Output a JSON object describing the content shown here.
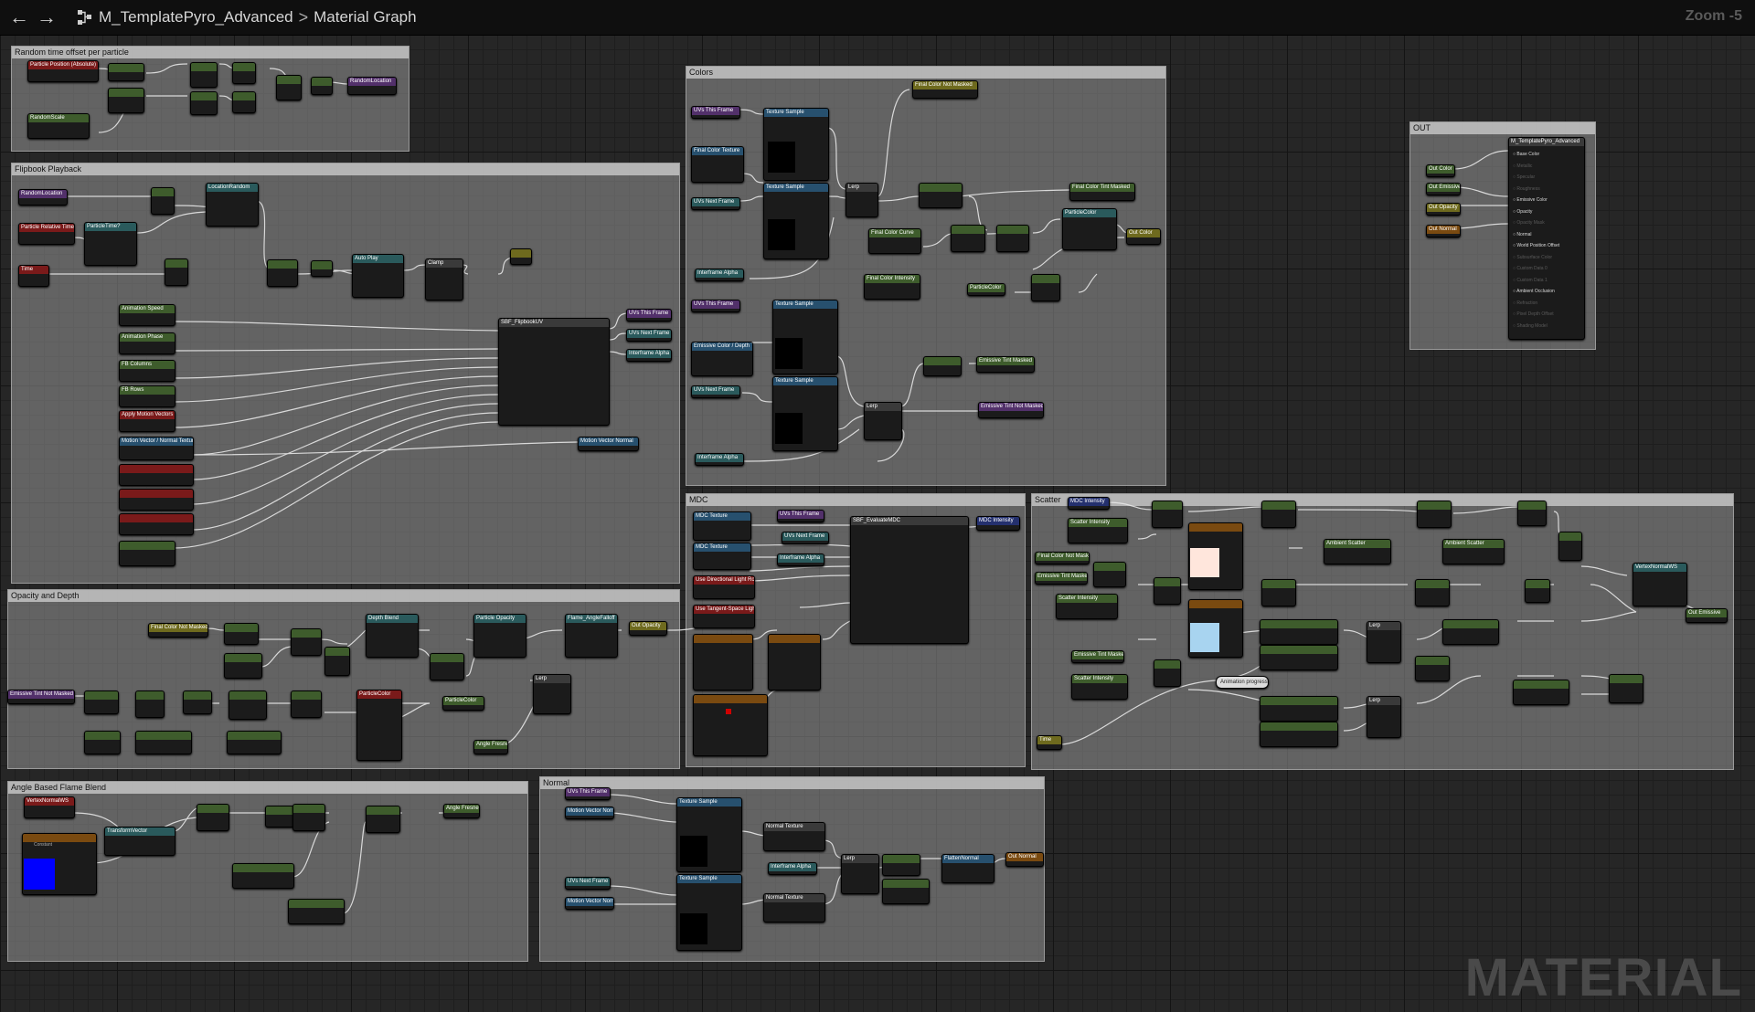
{
  "toolbar": {
    "back_icon": "arrow-left-icon",
    "forward_icon": "arrow-right-icon",
    "graph_icon": "material-graph-icon",
    "asset_name": "M_TemplatePyro_Advanced",
    "separator": ">",
    "graph_name": "Material Graph",
    "zoom": "Zoom -5"
  },
  "watermark": "MATERIAL",
  "comments": {
    "random_time": "Random time offset per particle",
    "flipbook": "Flipbook Playback",
    "colors": "Colors",
    "out": "OUT",
    "opacity_depth": "Opacity and Depth",
    "mdc": "MDC",
    "scatter": "Scatter",
    "angle_blend": "Angle Based Flame Blend",
    "normal": "Normal"
  },
  "nodes": {
    "particle_position": "Particle Position (Absolute)",
    "random_scale": "RandomScale",
    "random_location": "RandomLocation",
    "particle_relative_time": "Particle Relative Time",
    "particle_time": "ParticleTime?",
    "time": "Time",
    "location_random": "LocationRandom",
    "auto_play": "Auto Play",
    "clamp": "Clamp",
    "sf_flipbook": "SBF_FlipbookUV",
    "animation_speed": "Animation Speed",
    "animation_phase": "Animation Phase",
    "columns": "FB Columns",
    "rows": "FB Rows",
    "apply_motion_vectors": "Apply Motion Vectors",
    "motion_vector_texture": "Motion Vector / Normal Texture",
    "uv0_this_frame": "UVs This Frame",
    "uv_next_frame": "UVs Next Frame",
    "interframe_alpha": "Interframe Alpha",
    "motion_vector_normal": "Motion Vector Normal",
    "final_color_not_masked": "Final Color Not Masked",
    "texture_sample": "Texture Sample",
    "final_color_texture": "Final Color Texture",
    "final_color_tint": "Final Color Tint Masked",
    "final_color_curve": "Final Color Curve",
    "final_color_intensity": "Final Color Intensity",
    "particle_color": "ParticleColor",
    "emissive_color_depth": "Emissive Color / Depth Texture",
    "emissive_tint_masked": "Emissive Tint Masked",
    "emissive_tint_not_masked": "Emissive Tint Not Masked",
    "final_color_lerp": "Lerp",
    "out_node": "M_TemplatePyro_Advanced",
    "depth_blend": "Depth Blend",
    "particle_opacity": "Particle Opacity",
    "flame_angle_falloff": "Flame_AngleFalloff",
    "angle_fresnel": "Angle Fresnel",
    "mdc_texture": "MDC Texture",
    "mdc_intensity": "MDC Intensity",
    "sf_evaluate_mdc": "SBF_EvaluateMDC",
    "use_directional_light": "Use Directional Light Rotation",
    "use_tangent_space": "Use Tangent-Space Light Direction",
    "scatter_intensity": "Scatter Intensity",
    "ambient_scatter": "Ambient Scatter",
    "vertex_normal": "VertexNormalWS",
    "transform_vector": "TransformVector",
    "normal_texture": "Normal Texture",
    "flatten_normal": "FlattenNormal",
    "out_emissive": "Out Emissive",
    "out_opacity": "Out Opacity",
    "out_normal": "Out Normal",
    "out_color": "Out Color"
  },
  "out_pins": [
    "Base Color",
    "Metallic",
    "Specular",
    "Roughness",
    "Emissive Color",
    "Opacity",
    "Opacity Mask",
    "Normal",
    "World Position Offset",
    "Subsurface Color",
    "Custom Data 0",
    "Custom Data 1",
    "Ambient Occlusion",
    "Refraction",
    "Pixel Depth Offset",
    "Shading Model"
  ],
  "constant_blue_label": "Constant",
  "animation_progress": "Animation progress",
  "colors": {
    "wire": "#e6e6e6",
    "swatch_blue": "#0000ff",
    "swatch_peach": "#ffe6dc",
    "swatch_lightblue": "#a8d4f0",
    "swatch_red": "#d00000"
  }
}
